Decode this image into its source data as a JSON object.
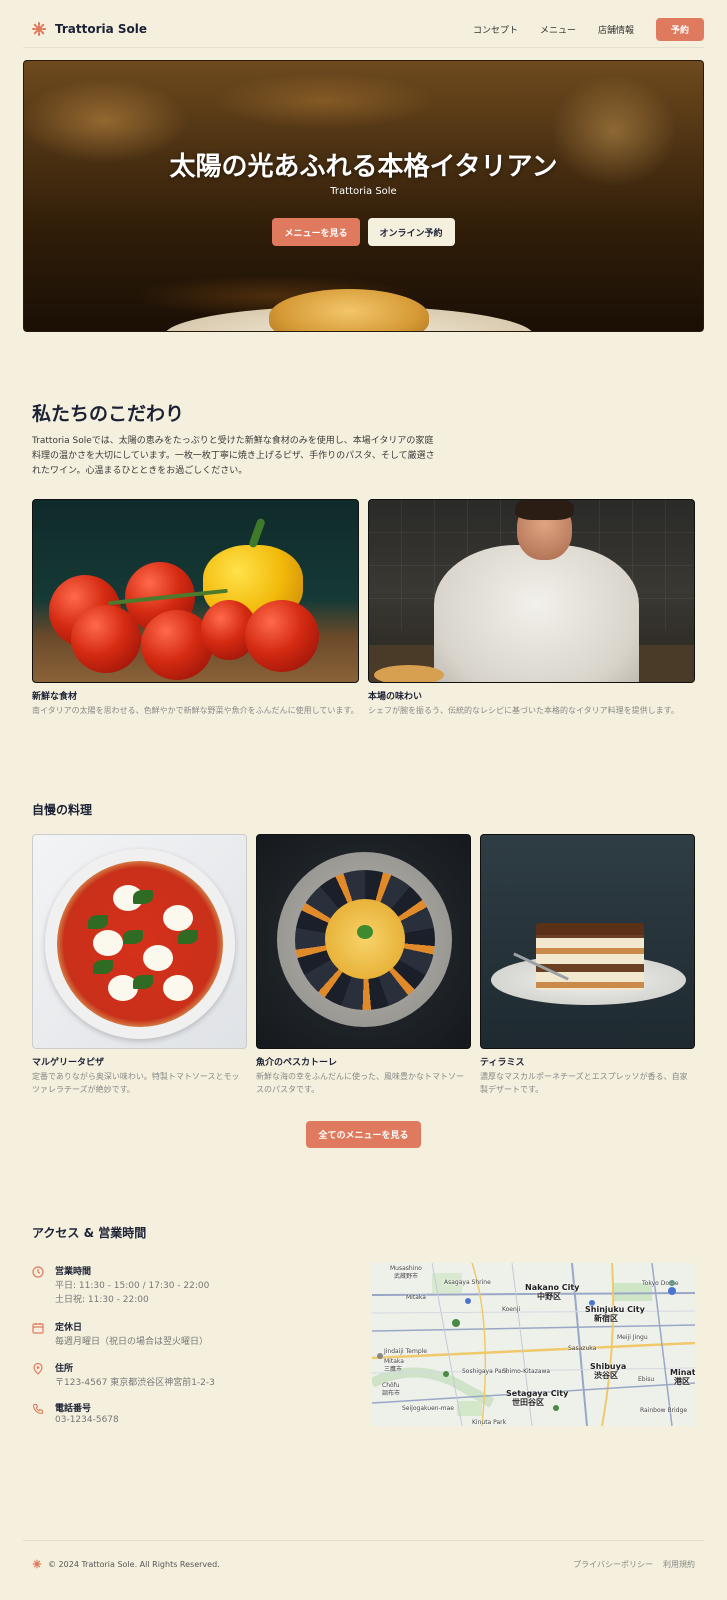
{
  "brand": {
    "name": "Trattoria Sole",
    "accent": "#e07a5f",
    "background": "#f4f0dd",
    "text": "#1c2136"
  },
  "nav": {
    "items": [
      "コンセプト",
      "メニュー",
      "店舗情報"
    ],
    "cta": "予約"
  },
  "hero": {
    "title": "太陽の光あふれる本格イタリアン",
    "subtitle": "Trattoria Sole",
    "primary_btn": "メニューを見る",
    "secondary_btn": "オンライン予約"
  },
  "concept": {
    "title": "私たちのこだわり",
    "text": "Trattoria Soleでは、太陽の恵みをたっぷりと受けた新鮮な食材のみを使用し、本場イタリアの家庭料理の温かさを大切にしています。一枚一枚丁寧に焼き上げるピザ、手作りのパスタ、そして厳選されたワイン。心温まるひとときをお過ごしください。",
    "cards": [
      {
        "title": "新鮮な食材",
        "desc": "南イタリアの太陽を思わせる、色鮮やかで新鮮な野菜や魚介をふんだんに使用しています。"
      },
      {
        "title": "本場の味わい",
        "desc": "シェフが腕を振るう、伝統的なレシピに基づいた本格的なイタリア料理を提供します。"
      }
    ]
  },
  "dishes": {
    "title": "自慢の料理",
    "items": [
      {
        "title": "マルゲリータピザ",
        "desc": "定番でありながら奥深い味わい。特製トマトソースとモッツァレラチーズが絶妙です。"
      },
      {
        "title": "魚介のペスカトーレ",
        "desc": "新鮮な海の幸をふんだんに使った、風味豊かなトマトソースのパスタです。"
      },
      {
        "title": "ティラミス",
        "desc": "濃厚なマスカルポーネチーズとエスプレッソが香る、自家製デザートです。"
      }
    ],
    "view_all": "全てのメニューを見る"
  },
  "access": {
    "title": "アクセス & 営業時間",
    "hours": {
      "label": "営業時間",
      "lines": [
        "平日: 11:30 - 15:00 / 17:30 - 22:00",
        "土日祝: 11:30 - 22:00"
      ]
    },
    "closed": {
      "label": "定休日",
      "lines": [
        "毎週月曜日（祝日の場合は翌火曜日）"
      ]
    },
    "address": {
      "label": "住所",
      "lines": [
        "〒123-4567 東京都渋谷区神宮前1-2-3"
      ]
    },
    "phone": {
      "label": "電話番号",
      "lines": [
        "03-1234-5678"
      ]
    },
    "map_labels": {
      "musashino": "Musashino",
      "musashino_jp": "武蔵野市",
      "asagaya": "Asagaya Shrine",
      "nakano": "Nakano City",
      "nakano_jp": "中野区",
      "shinjuku": "Shinjuku City",
      "shinjuku_jp": "新宿区",
      "tokyo_dome": "Tokyo Dome",
      "mitaka": "Mitaka",
      "mitaka_jp": "三鷹市",
      "shibuya": "Shibuya",
      "shibuya_jp": "渋谷区",
      "setagaya": "Setagaya City",
      "setagaya_jp": "世田谷区",
      "chofu": "Chōfu",
      "chofu_jp": "調布市",
      "minato": "Minato C",
      "minato_jp": "港区",
      "jindaiji": "Jindaiji Temple",
      "shimo_kitazawa": "Shimo-Kitazawa",
      "seijogakuen": "Seijogakuen-mae",
      "kinuta": "Kinuta Park",
      "rainbow": "Rainbow Bridge",
      "sasazuka": "Sasazuka",
      "koenji": "Koenji",
      "meiji_jingu": "Meiji Jingu",
      "soshigaya": "Soshigaya Park",
      "ebisu": "Ebisu"
    }
  },
  "footer": {
    "copyright": "© 2024 Trattoria Sole. All Rights Reserved.",
    "links": [
      "プライバシーポリシー",
      "利用規約"
    ]
  }
}
